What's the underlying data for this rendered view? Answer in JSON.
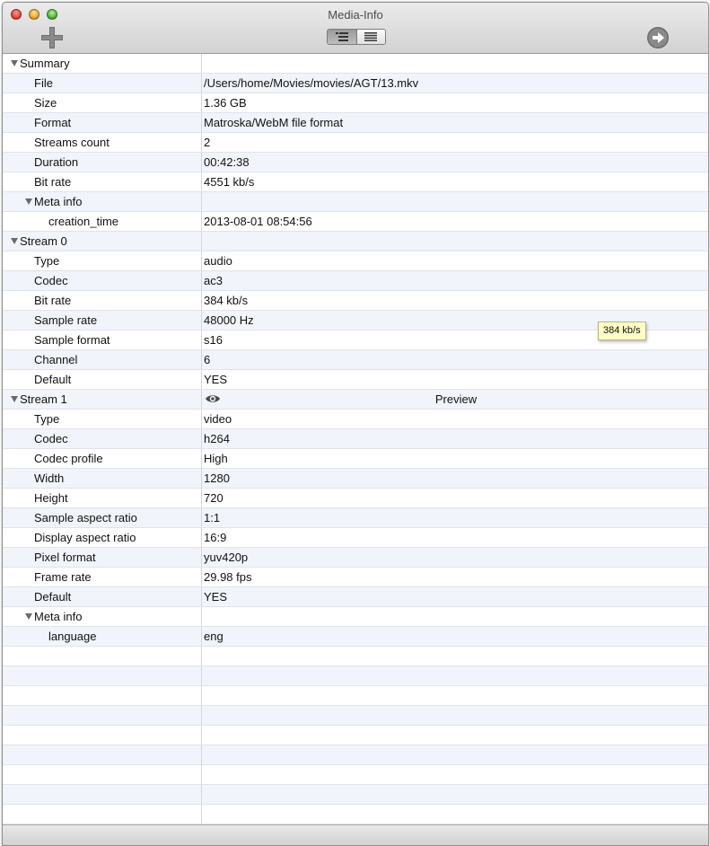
{
  "window": {
    "title": "Media-Info"
  },
  "toolbar": {
    "add_icon": "plus-icon",
    "view_icons": [
      "outline-view-icon",
      "list-view-icon"
    ],
    "go_icon": "arrow-right-icon"
  },
  "table": {
    "rows": [
      {
        "name": "Summary",
        "value": "",
        "level": 0,
        "expandable": true
      },
      {
        "name": "File",
        "value": "/Users/home/Movies/movies/AGT/13.mkv",
        "level": 1
      },
      {
        "name": "Size",
        "value": "1.36 GB",
        "level": 1
      },
      {
        "name": "Format",
        "value": "Matroska/WebM file format",
        "level": 1
      },
      {
        "name": "Streams count",
        "value": "2",
        "level": 1
      },
      {
        "name": "Duration",
        "value": "00:42:38",
        "level": 1
      },
      {
        "name": "Bit rate",
        "value": "4551 kb/s",
        "level": 1
      },
      {
        "name": "Meta info",
        "value": "",
        "level": 1,
        "expandable": true
      },
      {
        "name": "creation_time",
        "value": "2013-08-01 08:54:56",
        "level": 2
      },
      {
        "name": "Stream 0",
        "value": "",
        "level": 0,
        "expandable": true
      },
      {
        "name": "Type",
        "value": "audio",
        "level": 1
      },
      {
        "name": "Codec",
        "value": "ac3",
        "level": 1
      },
      {
        "name": "Bit rate",
        "value": "384 kb/s",
        "level": 1
      },
      {
        "name": "Sample rate",
        "value": "48000 Hz",
        "level": 1
      },
      {
        "name": "Sample format",
        "value": "s16",
        "level": 1
      },
      {
        "name": "Channel",
        "value": "6",
        "level": 1
      },
      {
        "name": "Default",
        "value": "YES",
        "level": 1
      },
      {
        "name": "Stream 1",
        "value": "",
        "level": 0,
        "expandable": true,
        "preview": "Preview"
      },
      {
        "name": "Type",
        "value": "video",
        "level": 1
      },
      {
        "name": "Codec",
        "value": "h264",
        "level": 1
      },
      {
        "name": "Codec profile",
        "value": "High",
        "level": 1
      },
      {
        "name": "Width",
        "value": "1280",
        "level": 1
      },
      {
        "name": "Height",
        "value": "720",
        "level": 1
      },
      {
        "name": "Sample aspect ratio",
        "value": "1:1",
        "level": 1
      },
      {
        "name": "Display aspect ratio",
        "value": "16:9",
        "level": 1
      },
      {
        "name": "Pixel format",
        "value": "yuv420p",
        "level": 1
      },
      {
        "name": "Frame rate",
        "value": "29.98 fps",
        "level": 1
      },
      {
        "name": "Default",
        "value": "YES",
        "level": 1
      },
      {
        "name": "Meta info",
        "value": "",
        "level": 1,
        "expandable": true
      },
      {
        "name": "language",
        "value": "eng",
        "level": 2
      }
    ]
  },
  "tooltip": {
    "text": "384 kb/s"
  }
}
